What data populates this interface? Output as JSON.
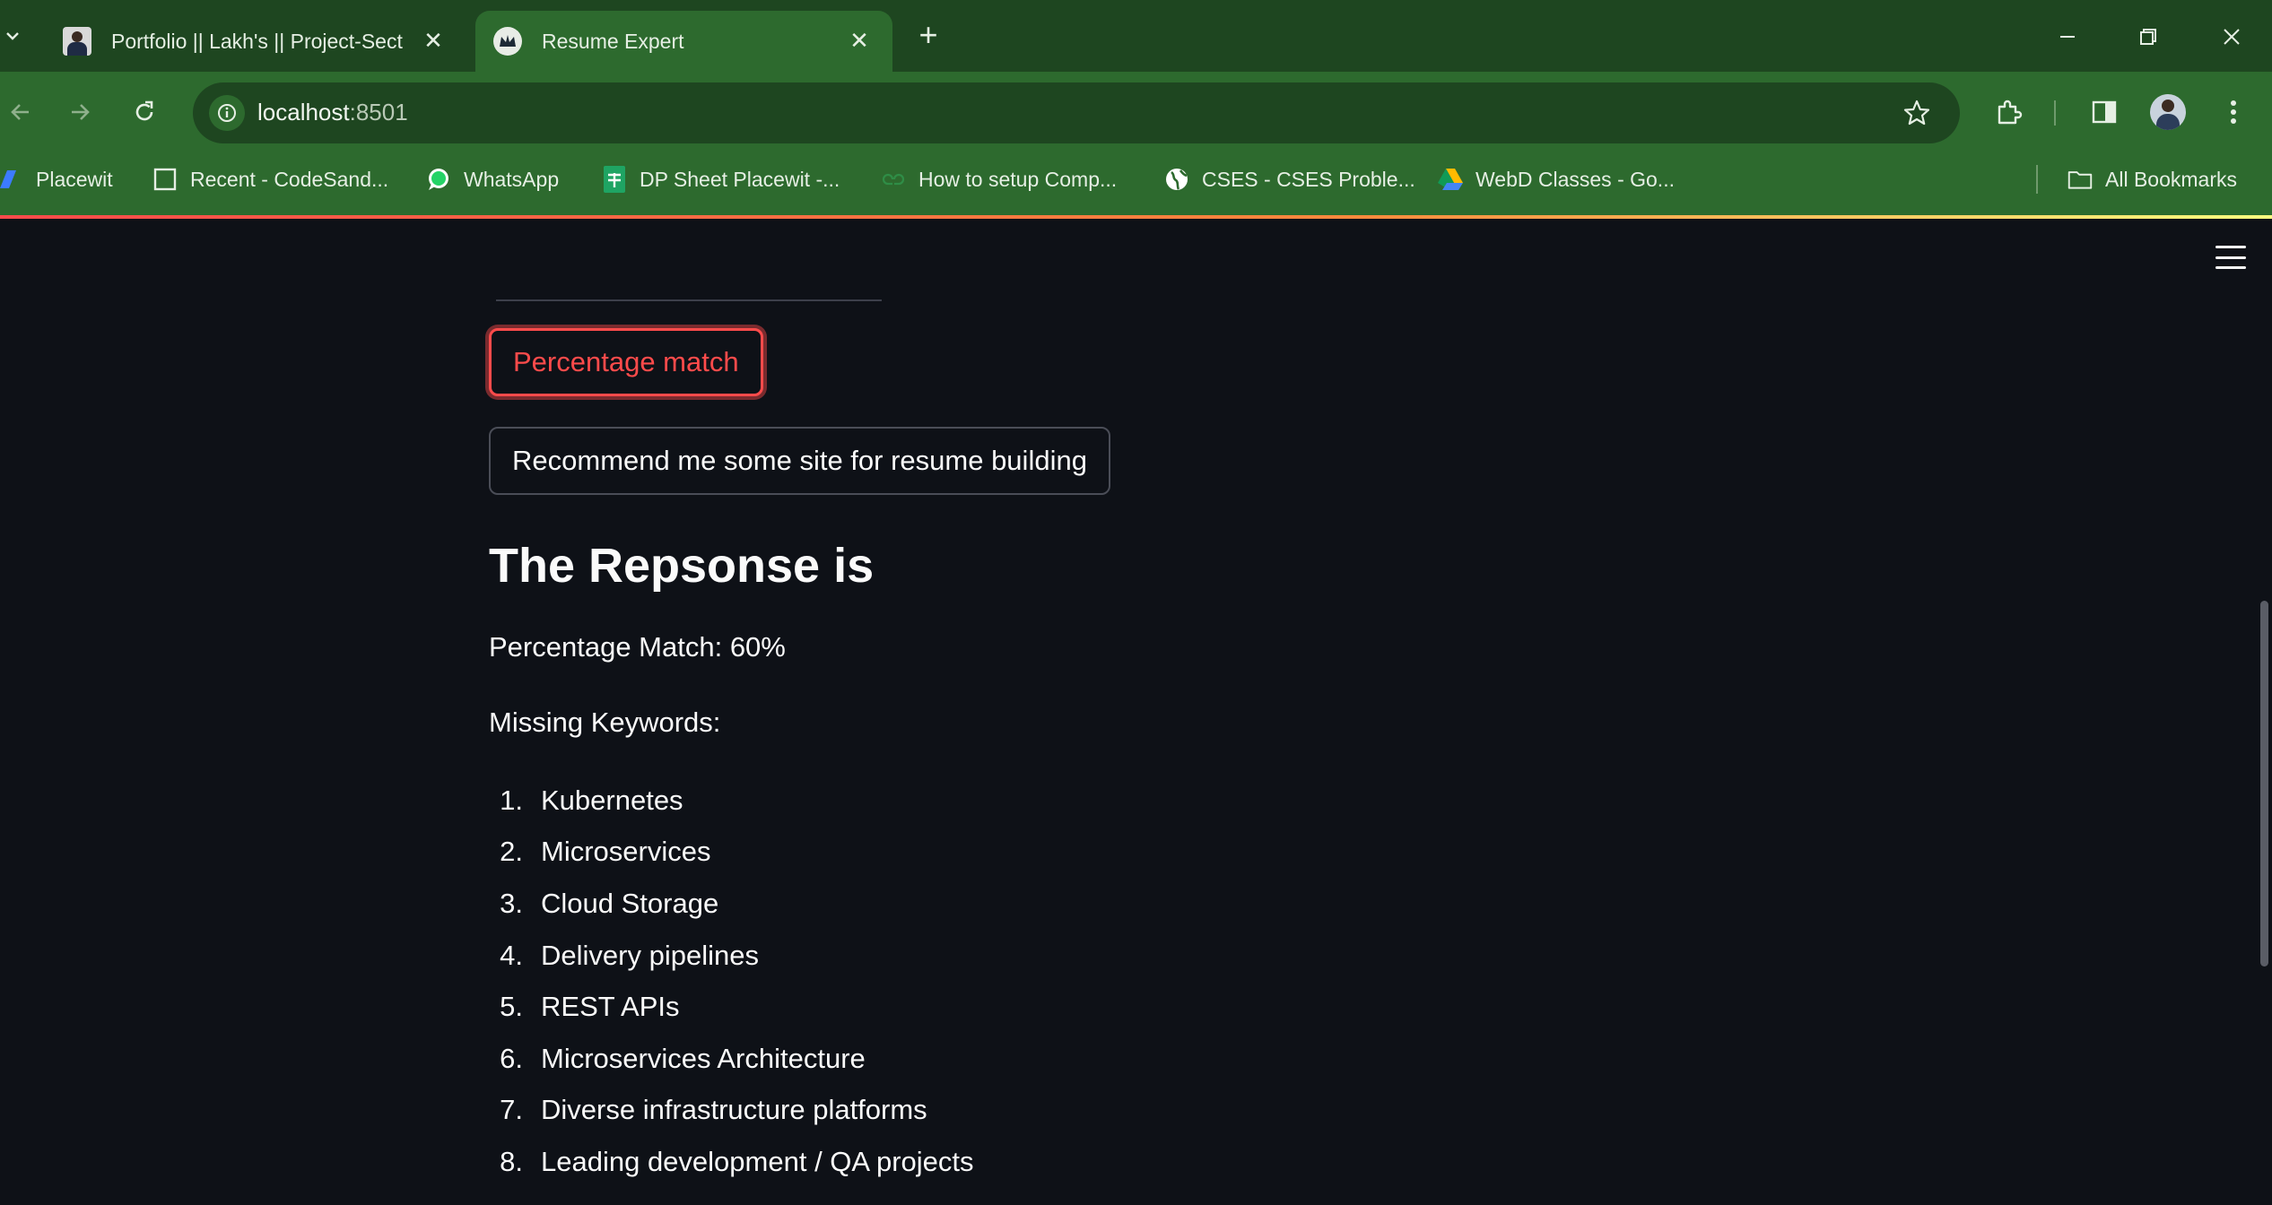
{
  "browser": {
    "tabs": [
      {
        "title": "Portfolio || Lakh's || Project-Sect",
        "favicon": "portrait-favicon",
        "active": false
      },
      {
        "title": "Resume Expert",
        "favicon": "streamlit-crown-favicon",
        "active": true
      }
    ],
    "address": {
      "host": "localhost",
      "port": ":8501"
    },
    "bookmarks": [
      {
        "label": "Placewit",
        "icon": "placewit-icon"
      },
      {
        "label": "Recent - CodeSand...",
        "icon": "codesandbox-icon"
      },
      {
        "label": "WhatsApp",
        "icon": "whatsapp-icon"
      },
      {
        "label": "DP Sheet Placewit -...",
        "icon": "google-sheets-icon"
      },
      {
        "label": "How to setup Comp...",
        "icon": "gfg-icon"
      },
      {
        "label": "CSES - CSES Proble...",
        "icon": "globe-icon"
      },
      {
        "label": "WebD Classes - Go...",
        "icon": "google-drive-icon"
      }
    ],
    "all_bookmarks": "All Bookmarks"
  },
  "colors": {
    "frame_dark": "#1e4620",
    "frame": "#2d6a2e",
    "page_bg": "#0e1117",
    "accent": "#ff4b4b",
    "text": "#fafafa"
  },
  "app": {
    "buttons": {
      "percentage_match": "Percentage match",
      "recommend_sites": "Recommend me some site for resume building"
    },
    "response_heading": "The Repsonse is",
    "percentage_match_line": "Percentage Match: 60%",
    "missing_keywords_label": "Missing Keywords:",
    "missing_keywords": [
      {
        "num": "1.",
        "text": "Kubernetes"
      },
      {
        "num": "2.",
        "text": "Microservices"
      },
      {
        "num": "3.",
        "text": "Cloud Storage"
      },
      {
        "num": "4.",
        "text": "Delivery pipelines"
      },
      {
        "num": "5.",
        "text": "REST APIs"
      },
      {
        "num": "6.",
        "text": "Microservices Architecture"
      },
      {
        "num": "7.",
        "text": "Diverse infrastructure platforms"
      },
      {
        "num": "8.",
        "text": "Leading development / QA projects"
      }
    ]
  }
}
